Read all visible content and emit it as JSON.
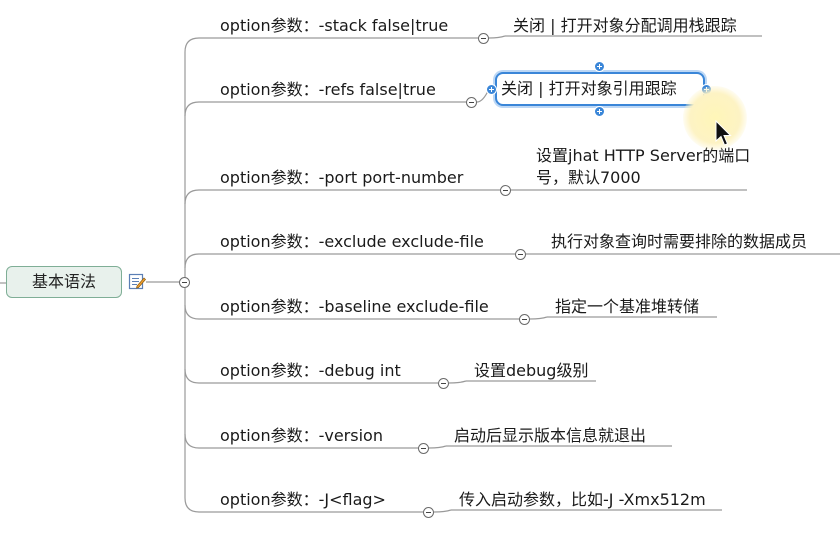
{
  "root": {
    "label": "基本语法",
    "note_icon": "note-edit-icon"
  },
  "branches": [
    {
      "topic": "option参数：-stack false|true",
      "detail": "关闭 | 打开对象分配调用栈跟踪"
    },
    {
      "topic": "option参数：-refs false|true",
      "detail": "关闭 | 打开对象引用跟踪",
      "selected": true
    },
    {
      "topic": "option参数：-port port-number",
      "detail": "设置jhat HTTP Server的端口号，默认7000"
    },
    {
      "topic": "option参数：-exclude exclude-file",
      "detail": "执行对象查询时需要排除的数据成员"
    },
    {
      "topic": "option参数：-baseline exclude-file",
      "detail": "指定一个基准堆转储"
    },
    {
      "topic": "option参数：-debug int",
      "detail": "设置debug级别"
    },
    {
      "topic": "option参数：-version",
      "detail": "启动后显示版本信息就退出"
    },
    {
      "topic": "option参数：-J<flag>",
      "detail": "传入启动参数，比如-J -Xmx512m"
    }
  ],
  "colors": {
    "line": "#9a9a9a",
    "root_border": "#7fae96",
    "root_fill": "#e8f1ec",
    "selection": "#3a86d8"
  }
}
